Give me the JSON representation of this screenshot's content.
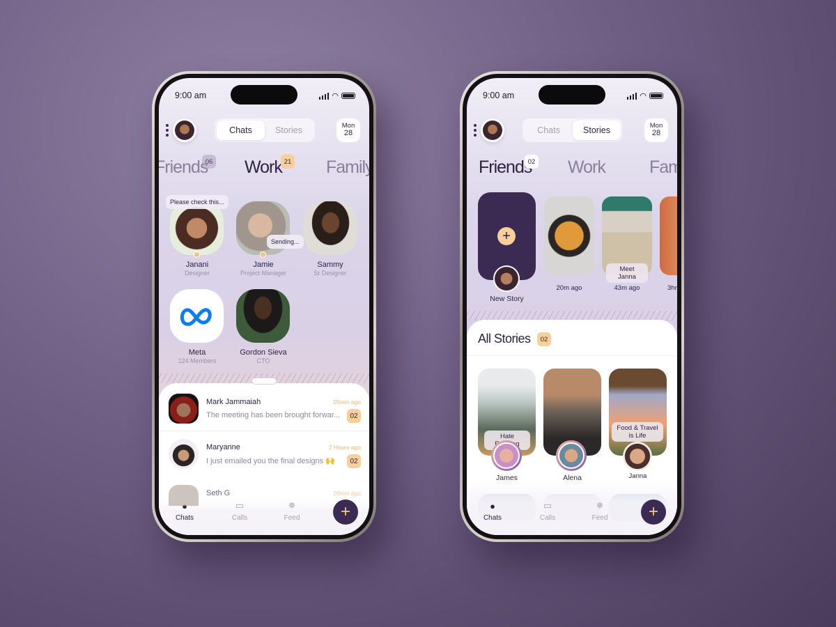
{
  "status_bar": {
    "time": "9:00 am"
  },
  "header": {
    "tabs": [
      "Chats",
      "Stories"
    ],
    "date_day": "Mon",
    "date_num": "28"
  },
  "colors": {
    "accent": "#3b2a52",
    "badge": "#f8cf98",
    "background": "#6f5f84"
  },
  "phone_chats": {
    "active_tab": "Chats",
    "categories": [
      {
        "label": "Friends",
        "badge": "06"
      },
      {
        "label": "Work",
        "badge": "21",
        "active": true
      },
      {
        "label": "Family"
      }
    ],
    "contacts": [
      {
        "name": "Janani",
        "role": "Designer",
        "bubble": "Please check this...",
        "online": true
      },
      {
        "name": "Jamie",
        "role": "Project Manager",
        "bubble": "Sending...",
        "online": true
      },
      {
        "name": "Sammy",
        "role": "Sr Designer"
      },
      {
        "name": "Meta",
        "role": "124 Members",
        "icon": "meta-logo"
      },
      {
        "name": "Gordon Sieva",
        "role": "CTO"
      }
    ],
    "chats": [
      {
        "name": "Mark Jammaiah",
        "message": "The meeting has been brought forwar...",
        "time": "05min ago",
        "unread": "02"
      },
      {
        "name": "Maryanne",
        "message": "I just emailed you the final designs 🙌",
        "time": "2 Hours ago",
        "unread": "02"
      },
      {
        "name": "Seth G",
        "time": "20min ago"
      }
    ]
  },
  "phone_stories": {
    "active_tab": "Stories",
    "categories": [
      {
        "label": "Friends",
        "badge": "02",
        "active": true
      },
      {
        "label": "Work"
      },
      {
        "label": "Fam"
      }
    ],
    "new_story_label": "New Story",
    "recent": [
      {
        "time": "20m ago"
      },
      {
        "time": "43m ago",
        "caption": "Meet Janna"
      },
      {
        "time": "3hr"
      }
    ],
    "all_stories_title": "All Stories",
    "all_stories_count": "02",
    "stories": [
      {
        "caption": "Hate Reading",
        "name": "James"
      },
      {
        "name": "Alena"
      },
      {
        "caption": "Food & Travel is Life",
        "name": "Janna"
      }
    ]
  },
  "nav": [
    {
      "label": "Chats",
      "icon": "chat-bubble-icon"
    },
    {
      "label": "Calls",
      "icon": "video-icon"
    },
    {
      "label": "Feed",
      "icon": "loader-icon"
    }
  ],
  "fab_label": "+"
}
